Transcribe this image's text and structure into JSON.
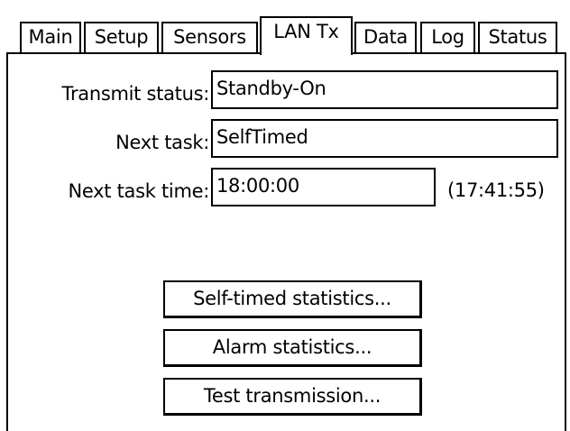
{
  "tabs": [
    {
      "label": "Main"
    },
    {
      "label": "Setup"
    },
    {
      "label": "Sensors"
    },
    {
      "label": "LAN Tx",
      "active": true
    },
    {
      "label": "Data"
    },
    {
      "label": "Log"
    },
    {
      "label": "Status"
    }
  ],
  "form": {
    "transmit_status_label": "Transmit status:",
    "transmit_status_value": "Standby-On",
    "next_task_label": "Next task:",
    "next_task_value": "SelfTimed",
    "next_task_time_label": "Next task time:",
    "next_task_time_value": "18:00:00",
    "current_time": "(17:41:55)"
  },
  "buttons": {
    "self_timed_stats": "Self-timed statistics...",
    "alarm_stats": "Alarm statistics...",
    "test_transmission": "Test transmission..."
  }
}
